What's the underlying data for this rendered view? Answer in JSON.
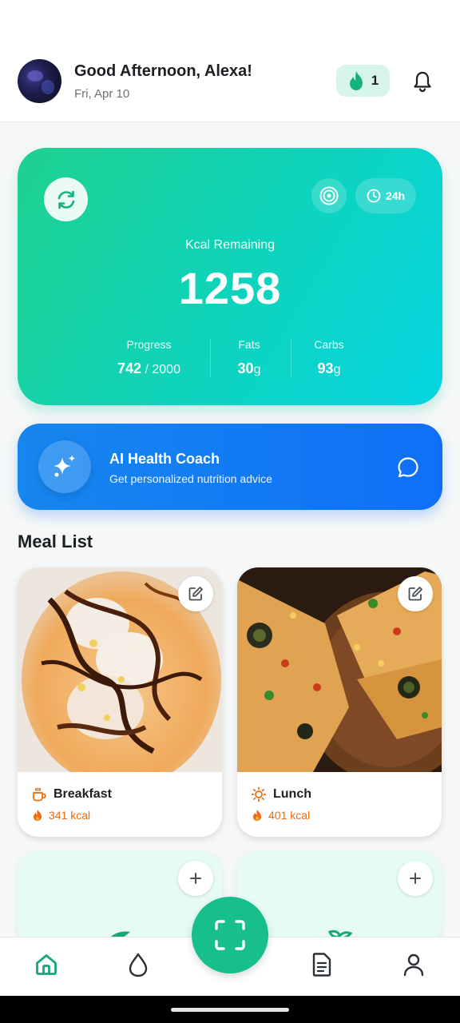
{
  "header": {
    "greeting": "Good Afternoon, Alexa!",
    "date": "Fri, Apr 10",
    "streak_count": "1"
  },
  "kcal_card": {
    "label": "Kcal Remaining",
    "value": "1258",
    "timeframe": "24h",
    "stats": {
      "progress": {
        "label": "Progress",
        "value": "742",
        "suffix": " / 2000"
      },
      "fats": {
        "label": "Fats",
        "value": "30",
        "unit": "g"
      },
      "carbs": {
        "label": "Carbs",
        "value": "93",
        "unit": "g"
      }
    }
  },
  "coach": {
    "title": "AI Health Coach",
    "subtitle": "Get personalized nutrition advice"
  },
  "meal_list": {
    "title": "Meal List",
    "meals": [
      {
        "name": "Breakfast",
        "kcal": "341 kcal",
        "icon": "coffee-icon"
      },
      {
        "name": "Lunch",
        "kcal": "401 kcal",
        "icon": "sun-icon"
      }
    ]
  },
  "nav": {
    "items": [
      "home-icon",
      "water-drop-icon",
      "scan-icon",
      "document-icon",
      "profile-icon"
    ]
  },
  "colors": {
    "accent_green": "#17bf8d",
    "coach_blue": "#0f6ff8",
    "kcal_orange": "#ea6a0c"
  }
}
